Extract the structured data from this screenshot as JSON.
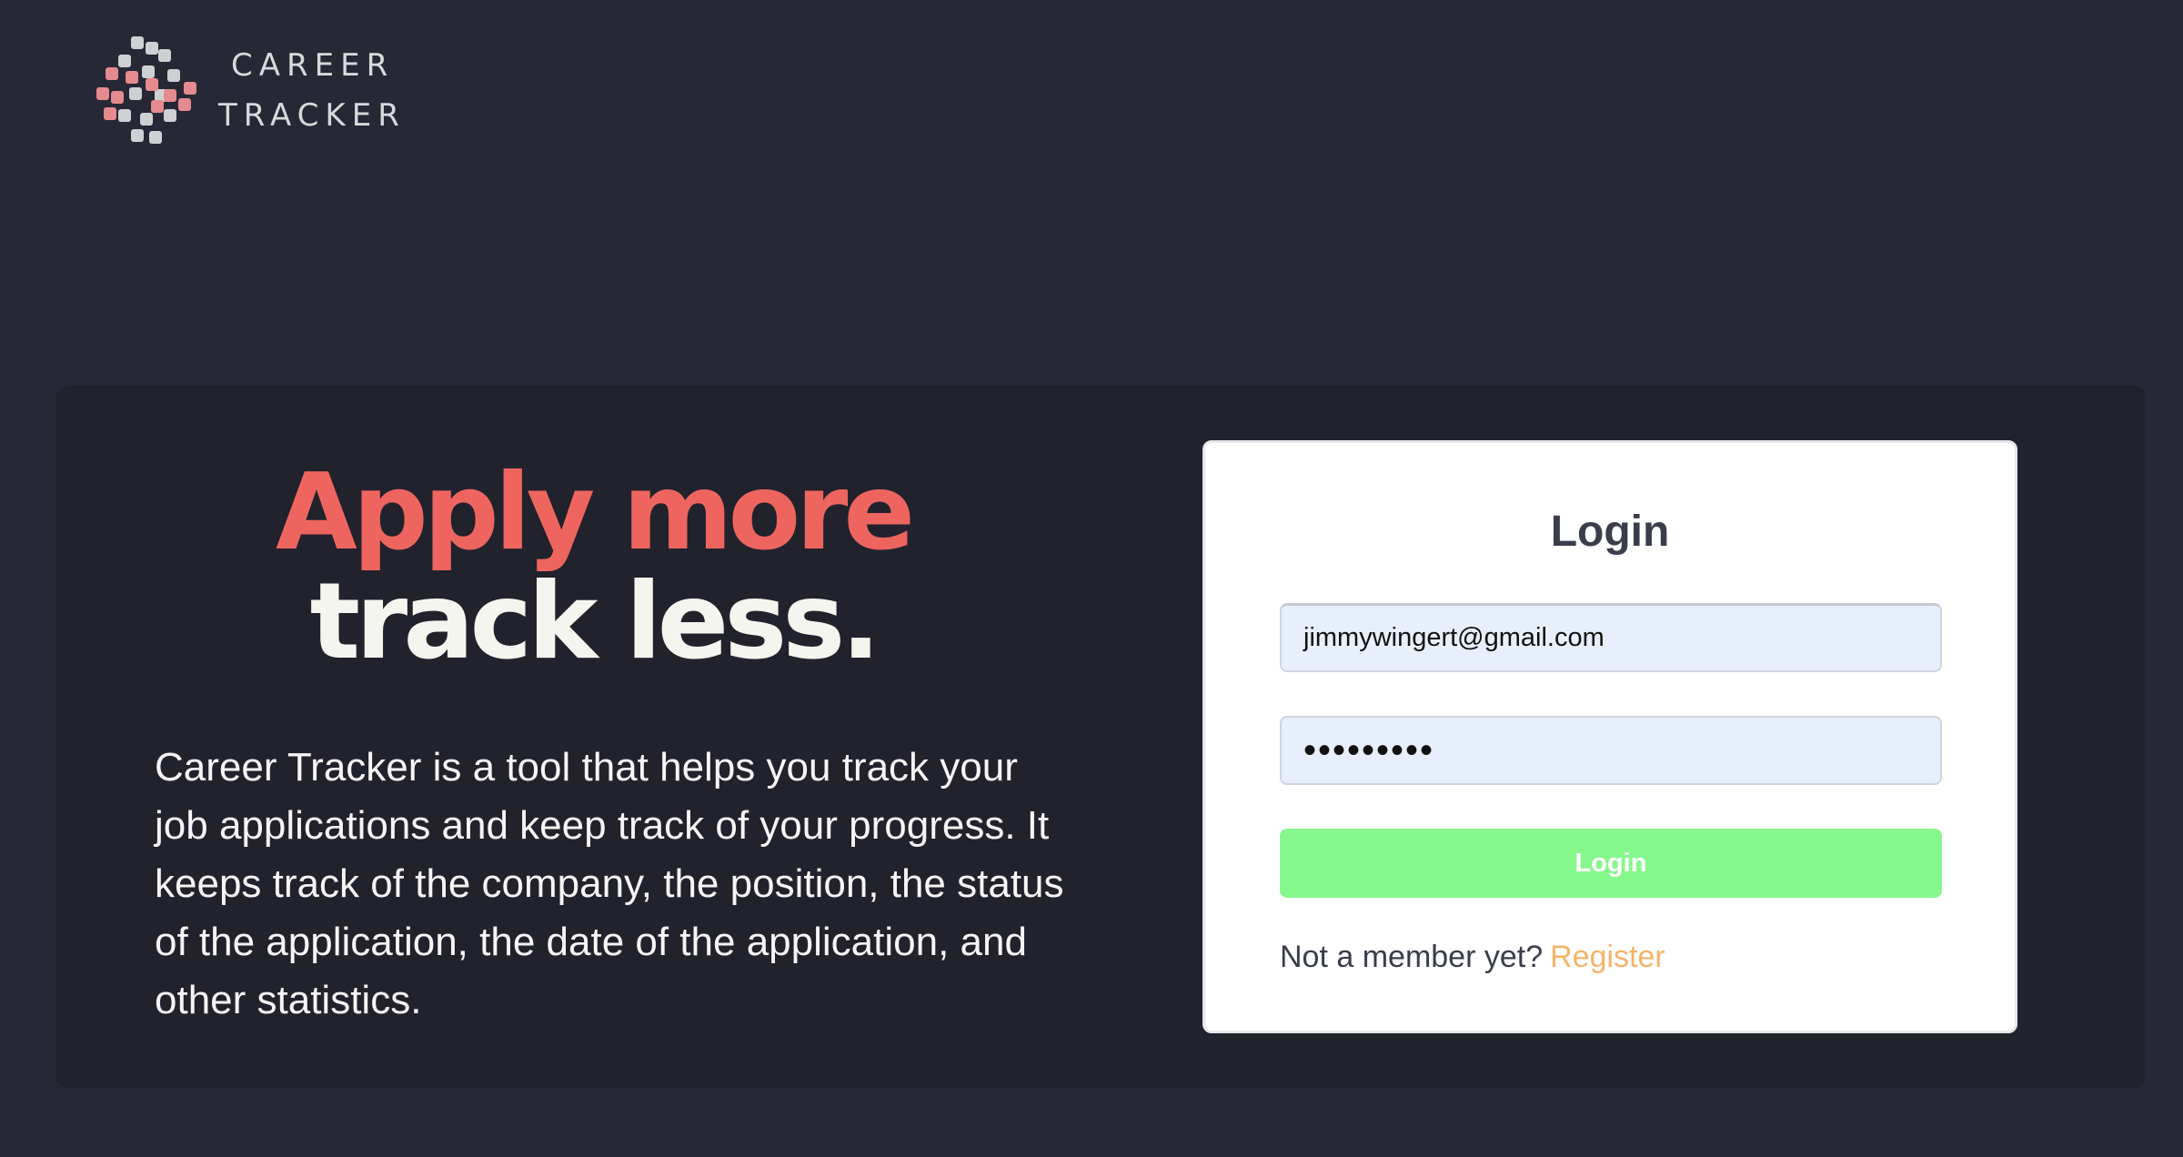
{
  "header": {
    "logo_line1": "CAREER",
    "logo_line2": "TRACKER",
    "colors": {
      "mark_pink": "#e58a8e",
      "mark_gray": "#cfd0d4"
    }
  },
  "hero": {
    "headline_line1": "Apply more",
    "headline_line2": "track less.",
    "description": "Career Tracker is a tool that helps you track your job applications and keep track of your progress. It keeps track of the company, the position, the status of the application, the date of the application, and other statistics."
  },
  "login": {
    "title": "Login",
    "email_value": "jimmywingert@gmail.com",
    "password_value": "•••••••••",
    "submit_label": "Login",
    "register_prompt": "Not a member yet?",
    "register_link": "Register"
  },
  "colors": {
    "background": "#262835",
    "card": "#21222c",
    "accent_red": "#ee6560",
    "button_green": "#86f78d",
    "link_orange": "#f5b46a"
  }
}
